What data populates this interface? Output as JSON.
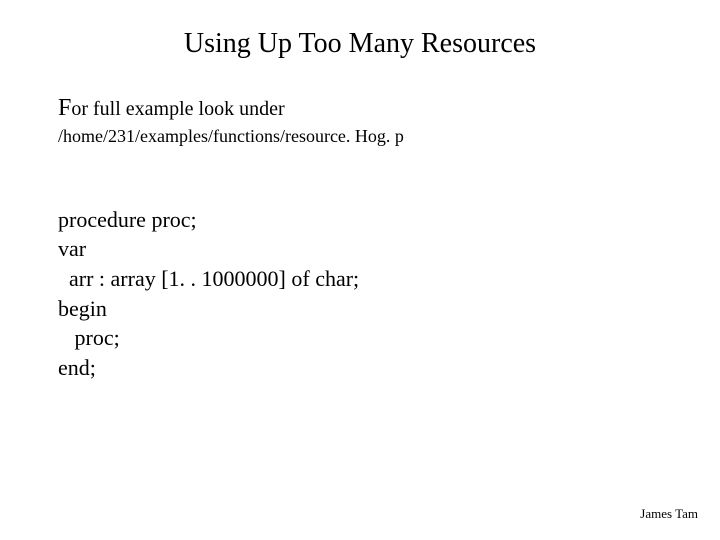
{
  "title": "Using Up Too Many Resources",
  "lead_cap": "F",
  "lead_rest": "or full example look under",
  "path": "/home/231/examples/functions/resource. Hog. p",
  "code": {
    "l1": "procedure proc;",
    "l2": "var",
    "l3": "  arr : array [1. . 1000000] of char;",
    "l4": "begin",
    "l5": "   proc;",
    "l6": "end;"
  },
  "footer": "James Tam"
}
